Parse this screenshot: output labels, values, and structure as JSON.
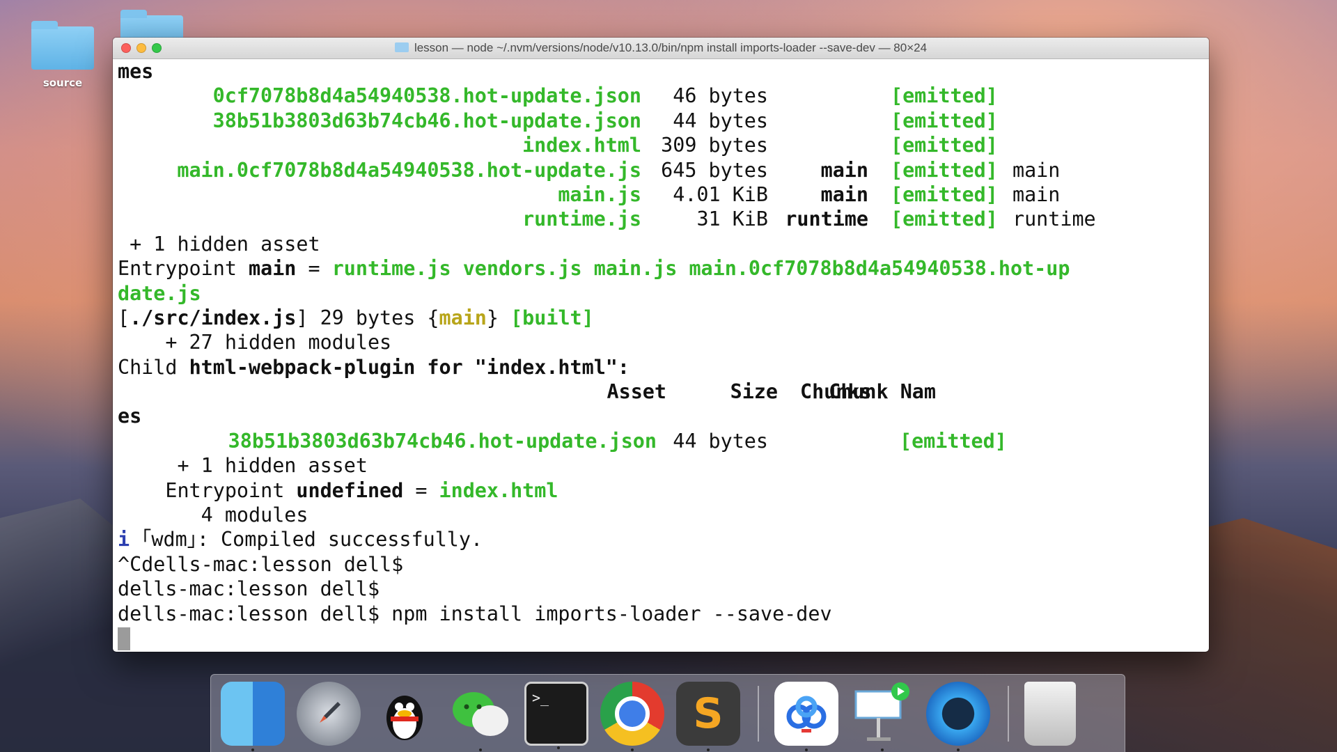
{
  "desktop": {
    "folder_label": "source"
  },
  "window": {
    "title": "lesson — node ~/.nvm/versions/node/v10.13.0/bin/npm install imports-loader --save-dev — 80×24"
  },
  "terminal": {
    "line0": "mes",
    "assets1": [
      {
        "name": "0cf7078b8d4a54940538.hot-update.json",
        "size": "46 bytes",
        "chunks": "",
        "emitted": "[emitted]",
        "chunk_names": ""
      },
      {
        "name": "38b51b3803d63b74cb46.hot-update.json",
        "size": "44 bytes",
        "chunks": "",
        "emitted": "[emitted]",
        "chunk_names": ""
      },
      {
        "name": "index.html",
        "size": "309 bytes",
        "chunks": "",
        "emitted": "[emitted]",
        "chunk_names": ""
      },
      {
        "name": "main.0cf7078b8d4a54940538.hot-update.js",
        "size": "645 bytes",
        "chunks": "main",
        "emitted": "[emitted]",
        "chunk_names": "main"
      },
      {
        "name": "main.js",
        "size": "4.01 KiB",
        "chunks": "main",
        "emitted": "[emitted]",
        "chunk_names": "main"
      },
      {
        "name": "runtime.js",
        "size": "31 KiB",
        "chunks": "runtime",
        "emitted": "[emitted]",
        "chunk_names": "runtime"
      }
    ],
    "hidden_asset_1": " + 1 hidden asset",
    "entry_label": "Entrypoint ",
    "entry_name": "main",
    "entry_eq": " = ",
    "entry_files_1": "runtime.js vendors.js main.js main.0cf7078b8d4a54940538.hot-up",
    "entry_files_2": "date.js",
    "built_open": "[",
    "built_path": "./src/index.js",
    "built_mid": "] 29 bytes {",
    "built_chunk": "main",
    "built_close": "} ",
    "built_tag": "[built]",
    "hidden_modules": "    + 27 hidden modules",
    "child_prefix": "Child ",
    "child_name": "html-webpack-plugin for \"index.html\":",
    "header": {
      "asset": "Asset",
      "size": "Size",
      "chunks": "Chunks",
      "chunk_names": "Chunk Nam"
    },
    "header_wrap": "es",
    "asset2": {
      "name": "38b51b3803d63b74cb46.hot-update.json",
      "size": "44 bytes",
      "emitted": "[emitted]"
    },
    "hidden_asset_2": "     + 1 hidden asset",
    "entry2_prefix": "    Entrypoint ",
    "entry2_name": "undefined",
    "entry2_eq": " = ",
    "entry2_file": "index.html",
    "modules": "       4 modules",
    "wdm_icon": "i",
    "wdm_text": " ｢wdm｣: Compiled successfully.",
    "prompt1": "^Cdells-mac:lesson dell$",
    "prompt2": "dells-mac:lesson dell$",
    "prompt3": "dells-mac:lesson dell$ npm install imports-loader --save-dev"
  },
  "dock": {
    "items": [
      "finder-icon",
      "launchpad-icon",
      "qq-icon",
      "wechat-icon",
      "terminal-icon",
      "chrome-icon",
      "sublime-text-icon",
      "baidu-netdisk-icon",
      "keynote-icon",
      "quicktime-icon",
      "trash-icon"
    ],
    "terminal_glyph": ">_",
    "sublime_glyph": "S"
  }
}
